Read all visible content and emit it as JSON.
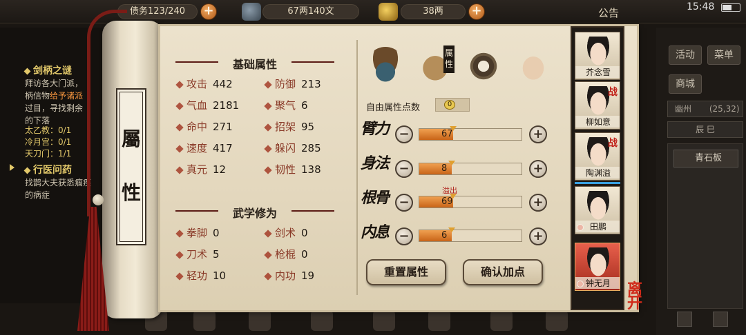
{
  "topbar": {
    "chip1": "债务123/240",
    "money": "67两140文",
    "gold": "38两",
    "notice": "公告",
    "time": "15:48"
  },
  "quests": [
    {
      "title": "剑柄之谜",
      "lines": [
        "拜访各大门派，",
        "柄信物给予诸派",
        "过目，寻找剩余",
        "的下落"
      ],
      "highlight": "给予诸派"
    },
    {
      "title": "行医问药",
      "lines": [
        "找鹊大夫获悉痼疾",
        "的病症"
      ]
    }
  ],
  "quest_progress": [
    "太乙教：0/1",
    "冷月宫：0/1",
    "天刀门：1/1"
  ],
  "right_panel": {
    "activity": "活动",
    "menu": "菜单",
    "shop": "商城",
    "location": "幽州",
    "coords": "(25,32)",
    "time_label": "辰 巳",
    "item": "青石板"
  },
  "scroll": {
    "title_char1": "屬",
    "title_char2": "性"
  },
  "basic": {
    "title": "基础属性",
    "stats": [
      {
        "label": "攻击",
        "value": "442"
      },
      {
        "label": "防御",
        "value": "213"
      },
      {
        "label": "气血",
        "value": "2181"
      },
      {
        "label": "聚气",
        "value": "6"
      },
      {
        "label": "命中",
        "value": "271"
      },
      {
        "label": "招架",
        "value": "95"
      },
      {
        "label": "速度",
        "value": "417"
      },
      {
        "label": "躲闪",
        "value": "285"
      },
      {
        "label": "真元",
        "value": "12"
      },
      {
        "label": "韧性",
        "value": "138"
      }
    ]
  },
  "martial": {
    "title": "武学修为",
    "stats": [
      {
        "label": "拳脚",
        "value": "0"
      },
      {
        "label": "剑术",
        "value": "0"
      },
      {
        "label": "刀术",
        "value": "5"
      },
      {
        "label": "枪棍",
        "value": "0"
      },
      {
        "label": "轻功",
        "value": "10"
      },
      {
        "label": "内功",
        "value": "19"
      }
    ]
  },
  "tabs": {
    "attr_flag": "属性"
  },
  "free_points": {
    "label": "自由属性点数",
    "value": "0"
  },
  "attributes": [
    {
      "name": "臂力",
      "value": "67",
      "fill": 0.33
    },
    {
      "name": "身法",
      "value": "8",
      "fill": 0.32
    },
    {
      "name": "根骨",
      "value": "69",
      "fill": 0.33
    },
    {
      "name": "内息",
      "value": "6",
      "fill": 0.32
    }
  ],
  "overflow_label": "溢出",
  "buttons": {
    "reset": "重置属性",
    "confirm": "确认加点"
  },
  "party": [
    {
      "name": "芥念雪",
      "war": ""
    },
    {
      "name": "柳如意",
      "war": "战"
    },
    {
      "name": "陶渊溢",
      "war": "战"
    },
    {
      "name": "田鹏",
      "war": ""
    },
    {
      "name": "钟无月",
      "war": ""
    }
  ],
  "leave_label": "离开"
}
